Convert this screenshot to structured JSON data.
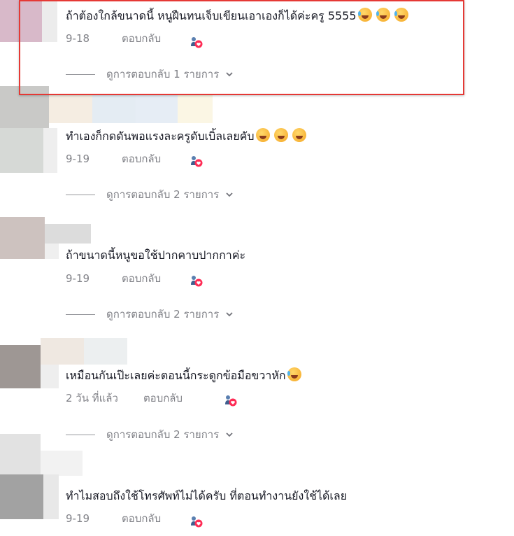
{
  "comments": [
    {
      "text": "ถ้าต้องใกล้ขนาดนี้ หนูฝืนทนเจ็บเขียนเอาเองก็ได้ค่ะครู 5555",
      "emoji": "rofl-emoji",
      "emoji_count": 3,
      "date": "9-18",
      "reply_label": "ตอบกลับ",
      "view_replies": "ดูการตอบกลับ 1 รายการ",
      "highlighted": true
    },
    {
      "text": "ทำเองก็กดดันพอแรงละครูดับเบิ้ลเลยคับ",
      "emoji": "grinning-sweat-emoji",
      "emoji_count": 3,
      "date": "9-19",
      "reply_label": "ตอบกลับ",
      "view_replies": "ดูการตอบกลับ 2 รายการ"
    },
    {
      "text": "ถ้าขนาดนี้หนูขอใช้ปากคาบปากกาค่ะ",
      "date": "9-19",
      "reply_label": "ตอบกลับ",
      "view_replies": "ดูการตอบกลับ 2 รายการ"
    },
    {
      "text": "เหมือนกันเป๊ะเลยค่ะตอนนี้กระดูกข้อมือขวาหัก",
      "emoji": "rofl-emoji",
      "emoji_count": 1,
      "date": "2 วัน ที่แล้ว",
      "reply_label": "ตอบกลับ",
      "view_replies": "ดูการตอบกลับ 2 รายการ"
    },
    {
      "text": "ทำไมสอบถึงใช้โทรศัพท์ไม่ได้ครับ ที่ตอนทำงานยังใช้ได้เลย",
      "date": "9-19",
      "reply_label": "ตอบกลับ"
    }
  ],
  "icons": {
    "like": "creator-liked-icon",
    "chevron": "chevron-down-icon"
  },
  "colors": {
    "highlight_border": "#e53935",
    "like_heart": "#fe2c55"
  }
}
